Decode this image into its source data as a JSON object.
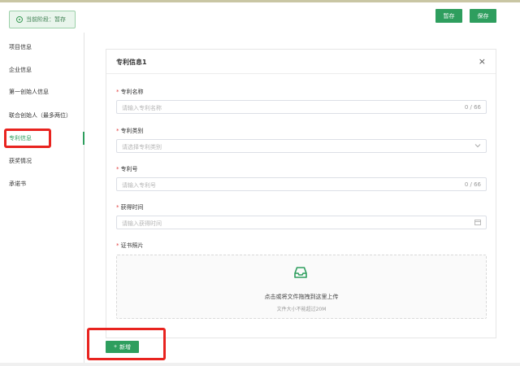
{
  "stage": {
    "label": "当前阶段：暂存"
  },
  "toolbar": {
    "save_draft_label": "暂存",
    "save_label": "保存"
  },
  "sidebar": {
    "items": [
      {
        "label": "项目信息",
        "active": false
      },
      {
        "label": "企业信息",
        "active": false
      },
      {
        "label": "第一创始人信息",
        "active": false
      },
      {
        "label": "联合创始人（最多两位）",
        "active": false
      },
      {
        "label": "专利信息",
        "active": true
      },
      {
        "label": "获奖情况",
        "active": false
      },
      {
        "label": "承诺书",
        "active": false
      }
    ]
  },
  "card": {
    "title": "专利信息1",
    "close": "×",
    "fields": {
      "name": {
        "label": "专利名称",
        "placeholder": "请输入专利名称",
        "count": "0 / 66"
      },
      "category": {
        "label": "专利类别",
        "placeholder": "请选择专利类别"
      },
      "number": {
        "label": "专利号",
        "placeholder": "请输入专利号",
        "count": "0 / 66"
      },
      "date": {
        "label": "获得时间",
        "placeholder": "请输入获得时间"
      },
      "certificate": {
        "label": "证书照片"
      }
    },
    "upload": {
      "hint": "点击或将文件拖拽到这里上传",
      "sub": "文件大小不能超过20M"
    }
  },
  "add_button": {
    "icon": "+",
    "label": "新增"
  },
  "colors": {
    "accent": "#2e9e5e",
    "highlight": "#e8231f",
    "required": "#e23c3c"
  }
}
